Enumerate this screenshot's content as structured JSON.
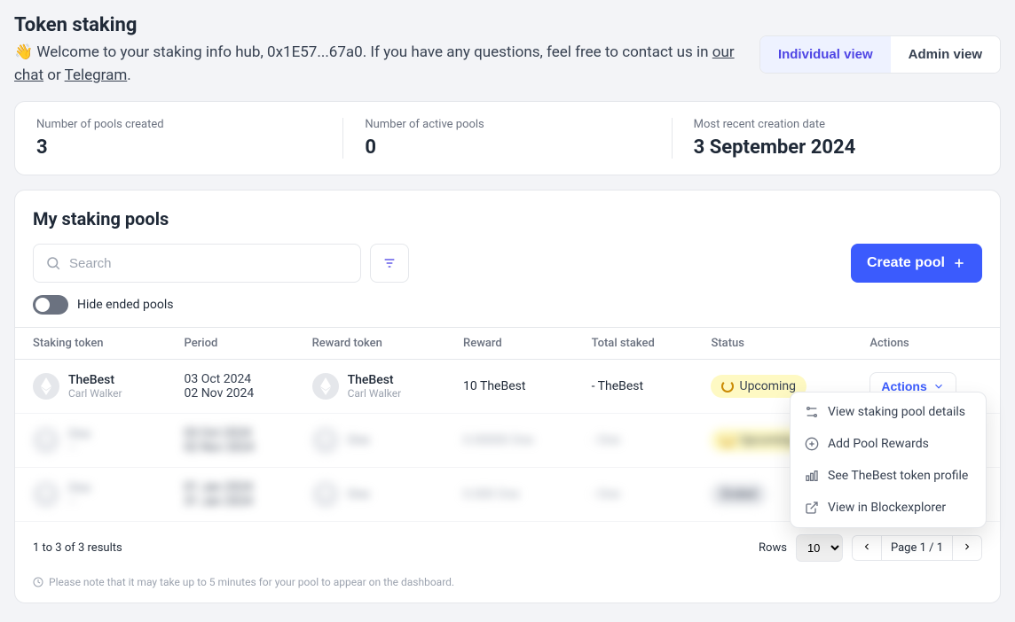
{
  "page": {
    "title": "Token staking",
    "welcome_prefix": "👋 Welcome to your staking info hub, ",
    "address": "0x1E57...67a0",
    "welcome_suffix": ". If you have any questions, feel free to contact us in ",
    "chat_link": "our chat",
    "or_text": " or ",
    "telegram_link": "Telegram",
    "view_individual": "Individual view",
    "view_admin": "Admin view"
  },
  "stats": [
    {
      "label": "Number of pools created",
      "value": "3"
    },
    {
      "label": "Number of active pools",
      "value": "0"
    },
    {
      "label": "Most recent creation date",
      "value": "3 September 2024"
    }
  ],
  "pools_section": {
    "title": "My staking pools",
    "search_placeholder": "Search",
    "create_label": "Create pool",
    "hide_ended_label": "Hide ended pools"
  },
  "table": {
    "headers": [
      "Staking token",
      "Period",
      "Reward token",
      "Reward",
      "Total staked",
      "Status",
      "Actions"
    ],
    "rows": [
      {
        "staking_token": {
          "name": "TheBest",
          "sub": "Carl Walker"
        },
        "period_from": "03 Oct 2024",
        "period_to": "02 Nov 2024",
        "reward_token": {
          "name": "TheBest",
          "sub": "Carl Walker"
        },
        "reward": "10 TheBest",
        "total_staked": "- TheBest",
        "status": "Upcoming",
        "status_type": "upcoming",
        "actions_label": "Actions"
      },
      {
        "staking_token": {
          "name": "One",
          "sub": "—"
        },
        "period_from": "03 Oct 2024",
        "period_to": "02 Nov 2024",
        "reward_token": {
          "name": "One",
          "sub": "—"
        },
        "reward": "0.00000 One",
        "total_staked": "- One",
        "status": "Upcoming",
        "status_type": "upcoming",
        "blurred": true
      },
      {
        "staking_token": {
          "name": "One",
          "sub": "—"
        },
        "period_from": "01 Jan 2024",
        "period_to": "31 Jan 2024",
        "reward_token": {
          "name": "One",
          "sub": "—"
        },
        "reward": "0.000 One",
        "total_staked": "- One",
        "status": "Ended",
        "status_type": "ended",
        "blurred": true
      }
    ]
  },
  "dropdown": {
    "items": [
      "View staking pool details",
      "Add Pool Rewards",
      "See TheBest token profile",
      "View in Blockexplorer"
    ]
  },
  "footer": {
    "results_text": "1 to 3 of 3 results",
    "rows_label": "Rows",
    "rows_value": "10",
    "page_text": "Page 1 / 1",
    "note": "Please note that it may take up to 5 minutes for your pool to appear on the dashboard."
  }
}
